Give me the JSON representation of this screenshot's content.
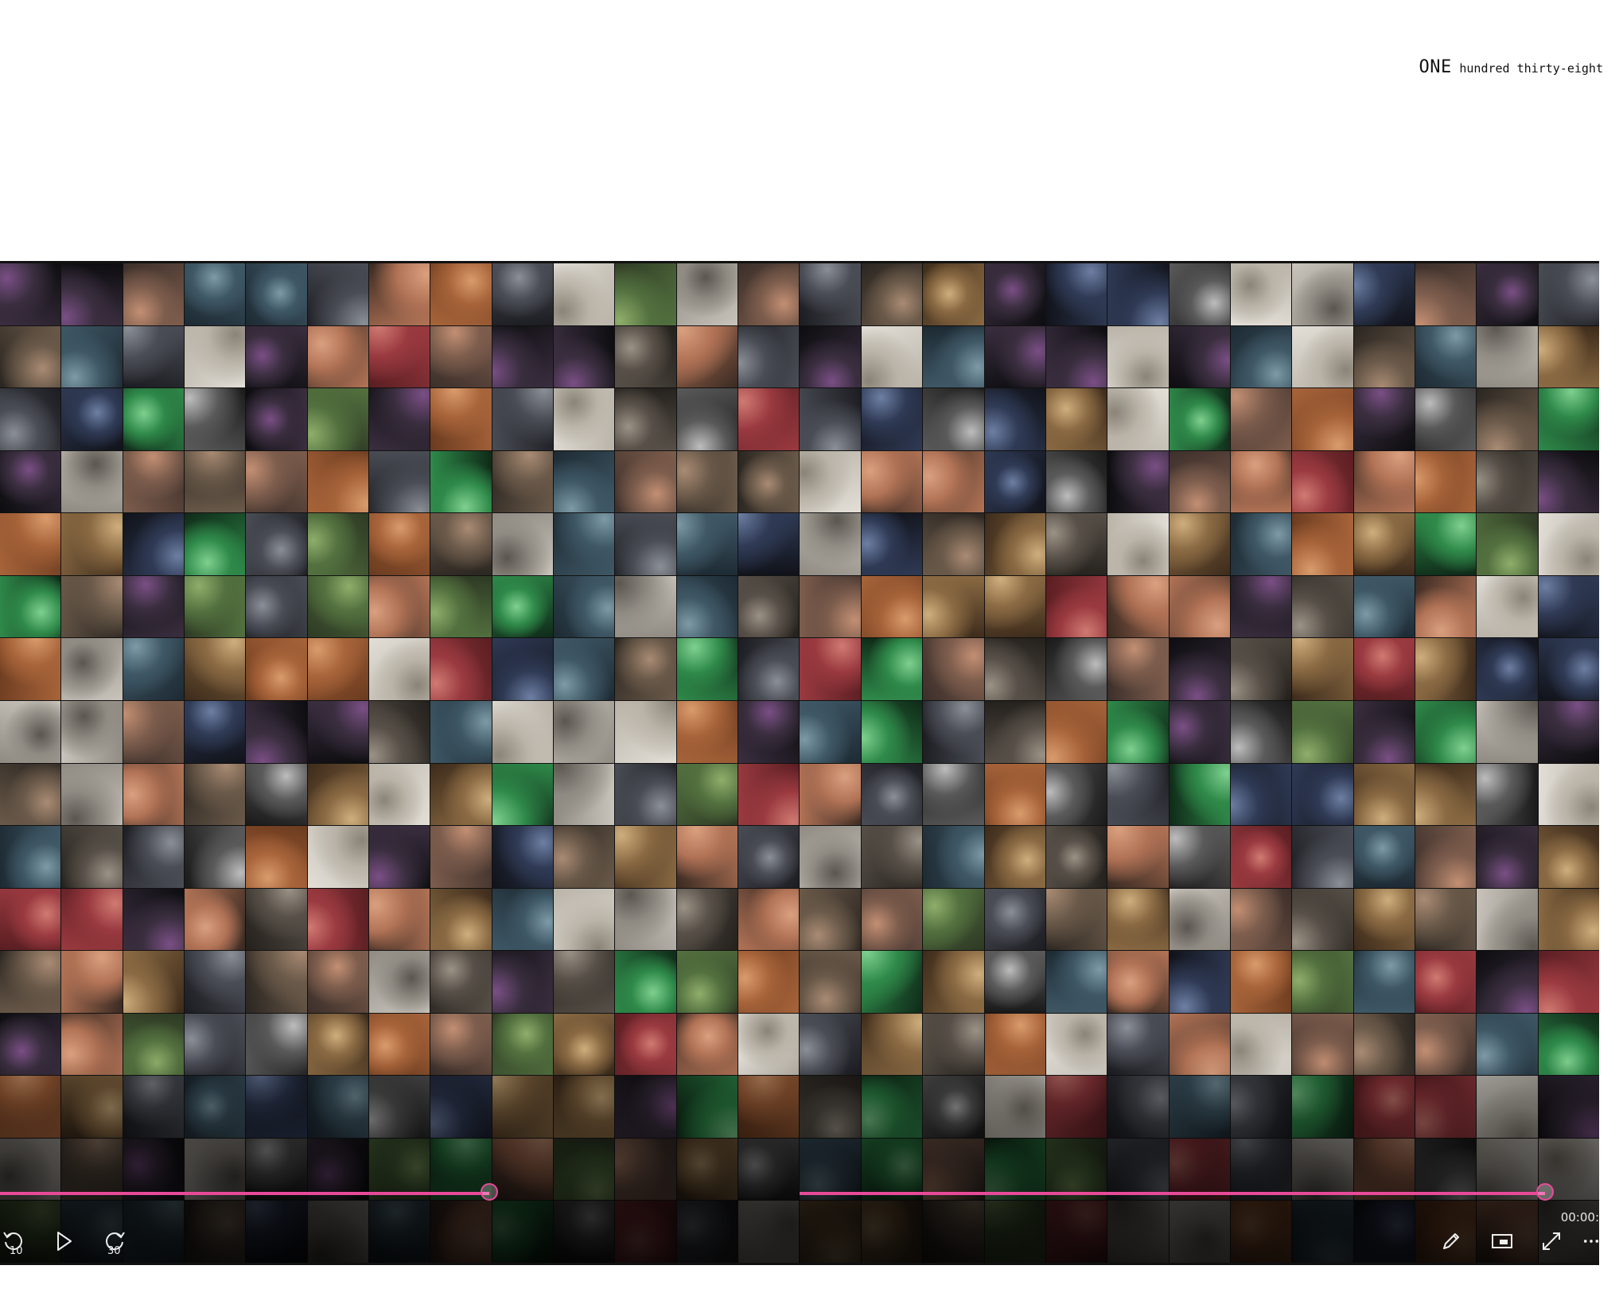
{
  "caption": {
    "emphasis": "ONE",
    "rest": "hundred thirty-eight"
  },
  "player": {
    "time": "00:00:",
    "replay_label": "10",
    "forward_label": "30",
    "seek_markers": [
      0.306,
      0.966
    ],
    "icons": [
      "replay-10-icon",
      "play-icon",
      "forward-30-icon",
      "pen-icon",
      "mini-player-icon",
      "fullscreen-icon",
      "more-icon"
    ]
  },
  "grid": {
    "columns": 26,
    "rows": 16
  }
}
